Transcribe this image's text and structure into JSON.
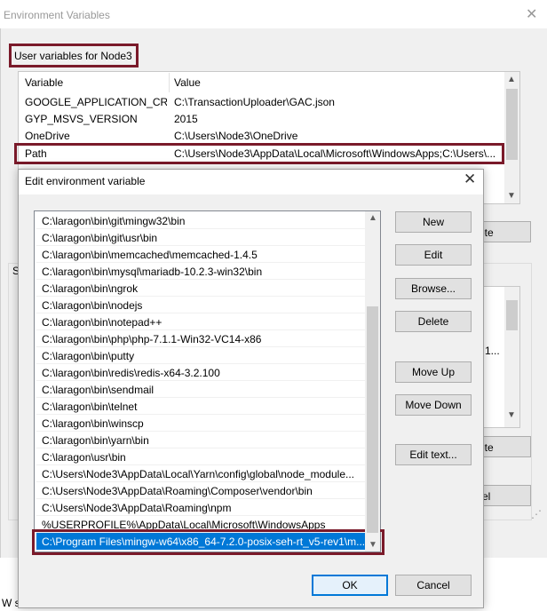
{
  "env_window": {
    "title": "Environment Variables",
    "close_glyph": "✕",
    "user_group_label": "User variables for Node3",
    "user_table": {
      "columns": [
        "Variable",
        "Value"
      ],
      "rows": [
        {
          "variable": "GOOGLE_APPLICATION_CRE...",
          "value": "C:\\TransactionUploader\\GAC.json"
        },
        {
          "variable": "GYP_MSVS_VERSION",
          "value": "2015"
        },
        {
          "variable": "OneDrive",
          "value": "C:\\Users\\Node3\\OneDrive"
        },
        {
          "variable": "Path",
          "value": "C:\\Users\\Node3\\AppData\\Local\\Microsoft\\WindowsApps;C:\\Users\\..."
        }
      ]
    },
    "partial_labels": {
      "user_delete_fragment": "ete",
      "system_group_fragment": "S",
      "system_value_fragment": "1...",
      "system_delete_fragment": "ete",
      "cancel_fragment": "el",
      "bottom_fragment": "W s"
    }
  },
  "edit_dialog": {
    "title": "Edit environment variable",
    "close_glyph": "✕",
    "paths": [
      "C:\\laragon\\bin\\git\\mingw32\\bin",
      "C:\\laragon\\bin\\git\\usr\\bin",
      "C:\\laragon\\bin\\memcached\\memcached-1.4.5",
      "C:\\laragon\\bin\\mysql\\mariadb-10.2.3-win32\\bin",
      "C:\\laragon\\bin\\ngrok",
      "C:\\laragon\\bin\\nodejs",
      "C:\\laragon\\bin\\notepad++",
      "C:\\laragon\\bin\\php\\php-7.1.1-Win32-VC14-x86",
      "C:\\laragon\\bin\\putty",
      "C:\\laragon\\bin\\redis\\redis-x64-3.2.100",
      "C:\\laragon\\bin\\sendmail",
      "C:\\laragon\\bin\\telnet",
      "C:\\laragon\\bin\\winscp",
      "C:\\laragon\\bin\\yarn\\bin",
      "C:\\laragon\\usr\\bin",
      "C:\\Users\\Node3\\AppData\\Local\\Yarn\\config\\global\\node_module...",
      "C:\\Users\\Node3\\AppData\\Roaming\\Composer\\vendor\\bin",
      "C:\\Users\\Node3\\AppData\\Roaming\\npm",
      "%USERPROFILE%\\AppData\\Local\\Microsoft\\WindowsApps",
      "C:\\Program Files\\mingw-w64\\x86_64-7.2.0-posix-seh-rt_v5-rev1\\m..."
    ],
    "buttons": {
      "new": "New",
      "edit": "Edit",
      "browse": "Browse...",
      "delete": "Delete",
      "move_up": "Move Up",
      "move_down": "Move Down",
      "edit_text": "Edit text...",
      "ok": "OK",
      "cancel": "Cancel"
    }
  },
  "colors": {
    "highlight_border": "#7a1a2a",
    "selection": "#0078d7"
  }
}
